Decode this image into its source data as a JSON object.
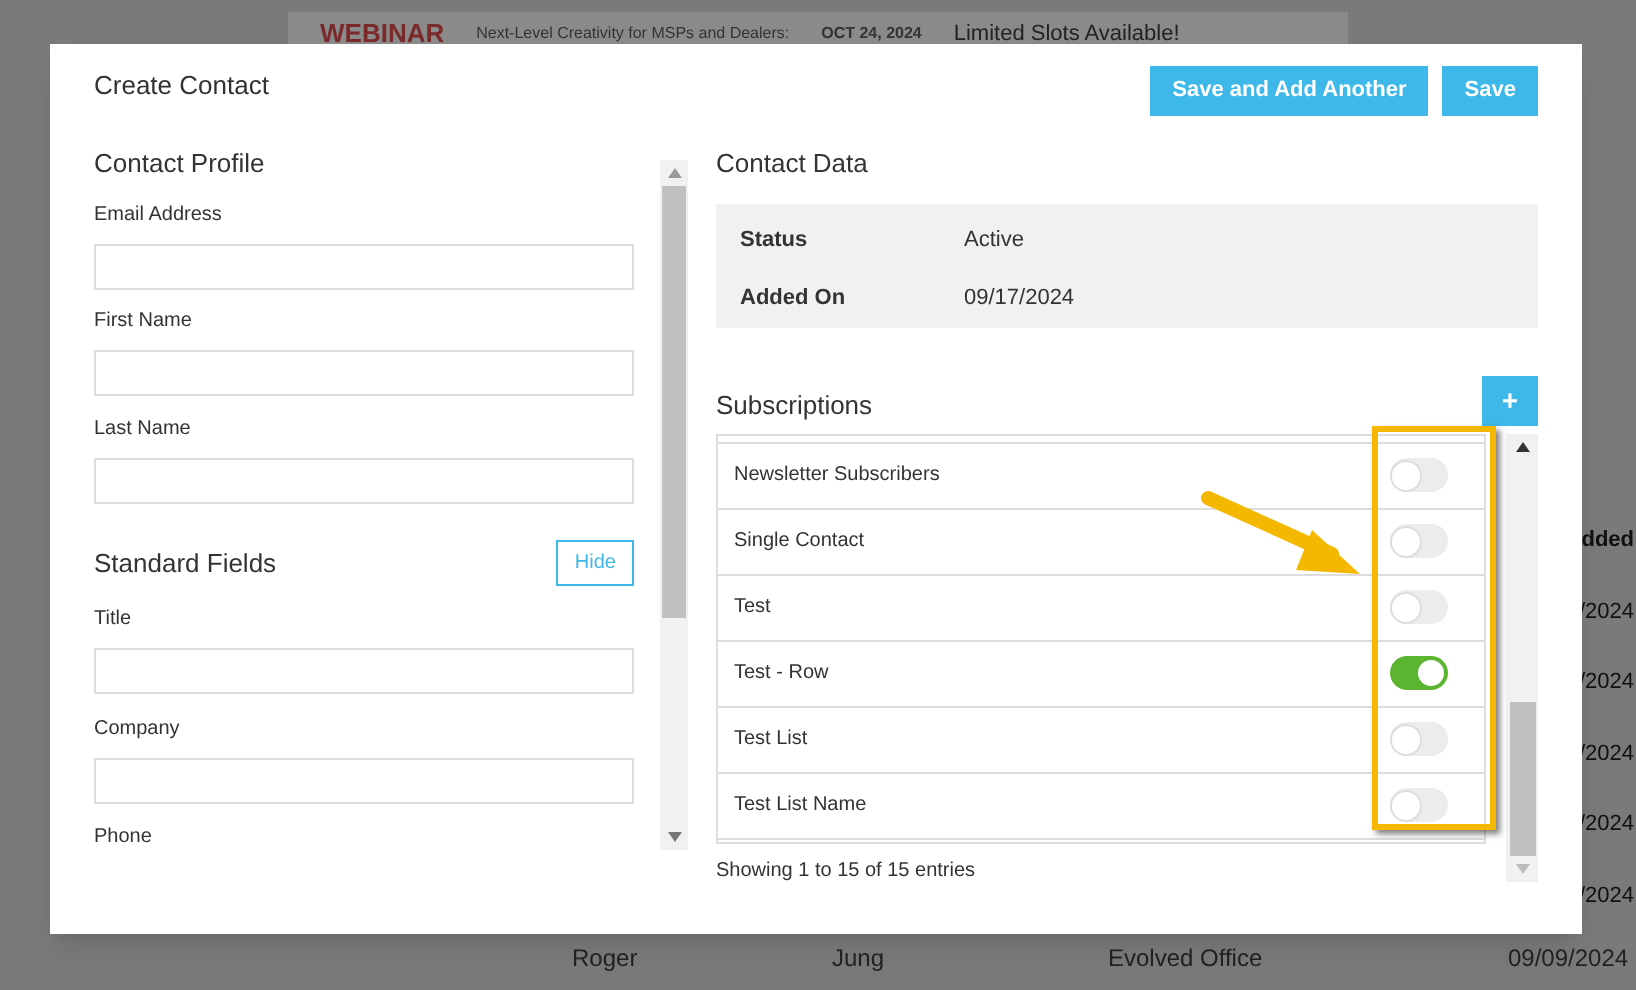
{
  "banner": {
    "badge": "WEBINAR",
    "headline": "Next-Level Creativity for MSPs and Dealers:",
    "date": "OCT 24, 2024",
    "cta": "Limited Slots Available!"
  },
  "background_table": {
    "header": "dded",
    "cells": [
      "/2024",
      "/2024",
      "/2024",
      "/2024",
      "/2024"
    ],
    "last_row": [
      "Roger",
      "Jung",
      "Evolved Office",
      "09/09/2024"
    ]
  },
  "modal": {
    "title": "Create Contact",
    "buttons": [
      "Save and Add Another",
      "Save"
    ],
    "profile": {
      "heading": "Contact Profile",
      "fields": [
        {
          "label": "Email Address"
        },
        {
          "label": "First Name"
        },
        {
          "label": "Last Name"
        }
      ]
    },
    "standard_fields": {
      "heading": "Standard Fields",
      "toggle_button": "Hide",
      "fields": [
        {
          "label": "Title"
        },
        {
          "label": "Company"
        }
      ],
      "cut_label": "Phone"
    },
    "contact_data": {
      "heading": "Contact Data",
      "rows": [
        {
          "label": "Status",
          "value": "Active"
        },
        {
          "label": "Added On",
          "value": "09/17/2024"
        }
      ]
    },
    "subscriptions": {
      "heading": "Subscriptions",
      "add_button": "+",
      "rows": [
        {
          "name": "Newsletter Subscribers",
          "on": false
        },
        {
          "name": "Single Contact",
          "on": false
        },
        {
          "name": "Test",
          "on": false
        },
        {
          "name": "Test - Row",
          "on": true
        },
        {
          "name": "Test List",
          "on": false
        },
        {
          "name": "Test List Name",
          "on": false
        }
      ],
      "footer": "Showing 1 to 15 of 15 entries"
    }
  }
}
